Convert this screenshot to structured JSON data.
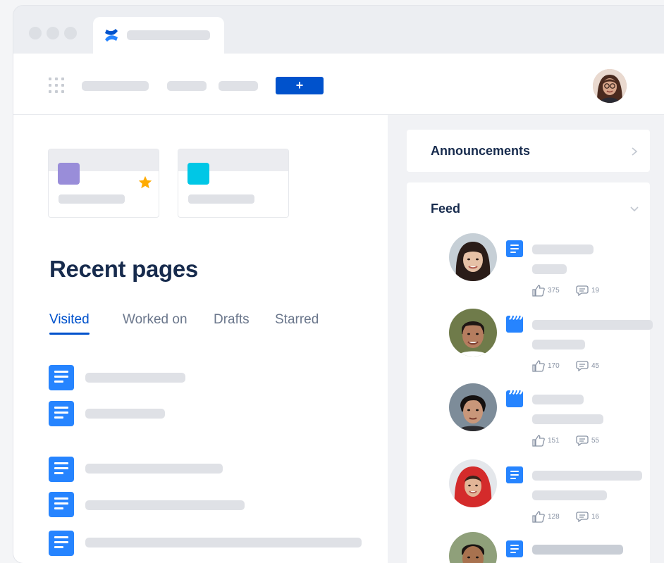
{
  "colors": {
    "primary": "#0052cc",
    "page_icon": "#2684ff",
    "space_purple": "#998dd9",
    "space_teal": "#00c7e6",
    "star": "#ffab00"
  },
  "toolbar": {
    "create_label": "+",
    "icons": [
      "app-switcher-icon",
      "confluence-logo-icon",
      "user-avatar"
    ]
  },
  "recent": {
    "title": "Recent pages",
    "tabs": [
      "Visited",
      "Worked on",
      "Drafts",
      "Starred"
    ],
    "active_tab": "Visited"
  },
  "sidebar": {
    "announcements_title": "Announcements",
    "feed_title": "Feed",
    "feed": [
      {
        "type": "page",
        "likes": "375",
        "comments": "19"
      },
      {
        "type": "quote",
        "likes": "170",
        "comments": "45"
      },
      {
        "type": "quote",
        "likes": "151",
        "comments": "55"
      },
      {
        "type": "page",
        "likes": "128",
        "comments": "16"
      },
      {
        "type": "page",
        "likes": "",
        "comments": ""
      }
    ]
  }
}
